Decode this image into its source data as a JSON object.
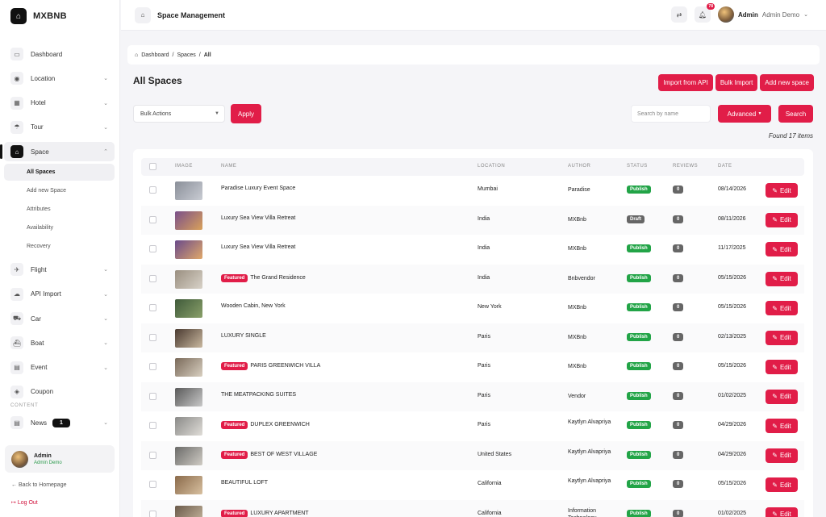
{
  "brand": {
    "name": "MXBNB",
    "logo_icon": "home-icon"
  },
  "sidebar": {
    "items": [
      {
        "label": "Dashboard",
        "icon": "monitor-icon",
        "glyph": "▭",
        "chevron": false
      },
      {
        "label": "Location",
        "icon": "compass-icon",
        "glyph": "◉",
        "chevron": true
      },
      {
        "label": "Hotel",
        "icon": "building-icon",
        "glyph": "▦",
        "chevron": true
      },
      {
        "label": "Tour",
        "icon": "umbrella-icon",
        "glyph": "☂",
        "chevron": true
      },
      {
        "label": "Space",
        "icon": "home-icon",
        "glyph": "⌂",
        "chevron": true,
        "active": true
      },
      {
        "label": "Flight",
        "icon": "plane-icon",
        "glyph": "✈",
        "chevron": true
      },
      {
        "label": "API Import",
        "icon": "cloud-download-icon",
        "glyph": "☁",
        "chevron": true
      },
      {
        "label": "Car",
        "icon": "car-icon",
        "glyph": "⛟",
        "chevron": true
      },
      {
        "label": "Boat",
        "icon": "boat-icon",
        "glyph": "⛴",
        "chevron": true
      },
      {
        "label": "Event",
        "icon": "calendar-icon",
        "glyph": "▤",
        "chevron": true
      },
      {
        "label": "Coupon",
        "icon": "ticket-icon",
        "glyph": "◈",
        "chevron": false
      }
    ],
    "sub_items": [
      "All Spaces",
      "Add new Space",
      "Attributes",
      "Availability",
      "Recovery"
    ],
    "section_label": "CONTENT",
    "news": {
      "label": "News",
      "badge": "1"
    },
    "user": {
      "name": "Admin",
      "role": "Admin Demo"
    },
    "back_link": "Back to Homepage",
    "logout": "Log Out"
  },
  "topbar": {
    "title": "Space Management",
    "notification_count": "78",
    "user_name": "Admin",
    "user_role": "Admin Demo"
  },
  "breadcrumb": {
    "home": "Dashboard",
    "sep": "/",
    "middle": "Spaces",
    "current": "All"
  },
  "page": {
    "heading": "All Spaces",
    "import_api": "Import from API",
    "bulk_import": "Bulk Import",
    "add_new": "Add new space",
    "bulk_actions": "Bulk Actions",
    "apply": "Apply",
    "search_placeholder": "Search by name",
    "advanced": "Advanced",
    "search": "Search",
    "found": "Found 17 items"
  },
  "table": {
    "headers": [
      "IMAGE",
      "NAME",
      "LOCATION",
      "AUTHOR",
      "STATUS",
      "REVIEWS",
      "DATE"
    ],
    "edit_label": "Edit",
    "featured_label": "Featured",
    "rows": [
      {
        "name": "Paradise Luxury Event Space",
        "featured": false,
        "location": "Mumbai",
        "author": "Paradise",
        "status": "Publish",
        "reviews": "0",
        "date": "08/14/2026",
        "thumb": [
          "#8a8f99",
          "#c9ccd3"
        ]
      },
      {
        "name": "Luxury Sea View Villa Retreat",
        "featured": false,
        "location": "India",
        "author": "MXBnb",
        "status": "Draft",
        "reviews": "0",
        "date": "08/11/2026",
        "thumb": [
          "#7a4f8a",
          "#d9a15a"
        ]
      },
      {
        "name": "Luxury Sea View Villa Retreat",
        "featured": false,
        "location": "India",
        "author": "MXBnb",
        "status": "Publish",
        "reviews": "0",
        "date": "11/17/2025",
        "thumb": [
          "#6a4a8a",
          "#e0a86a"
        ]
      },
      {
        "name": "The Grand Residence",
        "featured": true,
        "location": "India",
        "author": "Bnbvendor",
        "status": "Publish",
        "reviews": "0",
        "date": "05/15/2026",
        "thumb": [
          "#9a8f80",
          "#d8d2c8"
        ]
      },
      {
        "name": "Wooden Cabin, New York",
        "featured": false,
        "location": "New York",
        "author": "MXBnb",
        "status": "Publish",
        "reviews": "0",
        "date": "05/15/2026",
        "thumb": [
          "#3f5a3a",
          "#8aa06a"
        ]
      },
      {
        "name": "LUXURY SINGLE",
        "featured": false,
        "location": "Paris",
        "author": "MXBnb",
        "status": "Publish",
        "reviews": "0",
        "date": "02/13/2025",
        "thumb": [
          "#4a3a30",
          "#c9b8a0"
        ]
      },
      {
        "name": "PARIS GREENWICH VILLA",
        "featured": true,
        "location": "Paris",
        "author": "MXBnb",
        "status": "Publish",
        "reviews": "0",
        "date": "05/15/2026",
        "thumb": [
          "#7a6a5a",
          "#d8cfc0"
        ]
      },
      {
        "name": "THE MEATPACKING SUITES",
        "featured": false,
        "location": "Paris",
        "author": "Vendor",
        "status": "Publish",
        "reviews": "0",
        "date": "01/02/2025",
        "thumb": [
          "#5a5a5a",
          "#c8c8c8"
        ]
      },
      {
        "name": "DUPLEX GREENWICH",
        "featured": true,
        "location": "Paris",
        "author": "Kaytlyn Alvapriya",
        "status": "Publish",
        "reviews": "0",
        "date": "04/29/2026",
        "thumb": [
          "#8a8a88",
          "#e0ddd8"
        ]
      },
      {
        "name": "BEST OF WEST VILLAGE",
        "featured": true,
        "location": "United States",
        "author": "Kaytlyn Alvapriya",
        "status": "Publish",
        "reviews": "0",
        "date": "04/29/2026",
        "thumb": [
          "#6a6a68",
          "#d0ccc5"
        ]
      },
      {
        "name": "BEAUTIFUL LOFT",
        "featured": false,
        "location": "California",
        "author": "Kaytlyn Alvapriya",
        "status": "Publish",
        "reviews": "0",
        "date": "05/15/2026",
        "thumb": [
          "#8a6a4a",
          "#d8c0a0"
        ]
      },
      {
        "name": "LUXURY APARTMENT",
        "featured": true,
        "location": "California",
        "author": "Information Technology",
        "status": "Publish",
        "reviews": "0",
        "date": "01/02/2025",
        "thumb": [
          "#6a5a4a",
          "#c8b8a0"
        ]
      }
    ]
  }
}
